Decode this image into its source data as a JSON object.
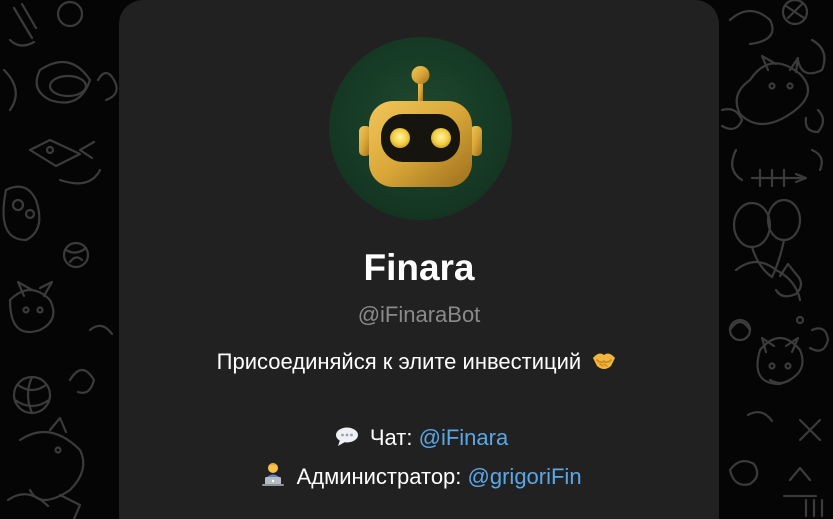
{
  "bot": {
    "name": "Finara",
    "username": "@iFinaraBot",
    "tagline": "Присоединяйся к элите инвестиций",
    "chat_label": "Чат:",
    "chat_link": "@iFinara",
    "admin_label": "Администратор:",
    "admin_link": "@grigoriFin"
  },
  "icons": {
    "avatar": "robot-avatar-icon",
    "tagline_emoji": "handshake-icon",
    "chat_emoji": "speech-bubble-icon",
    "admin_emoji": "technologist-icon"
  },
  "colors": {
    "card_bg": "#212121",
    "link": "#5aa7e8",
    "muted": "#8a8a8a",
    "avatar_bg": "#163a25",
    "robot_gold": "#d9a738"
  }
}
